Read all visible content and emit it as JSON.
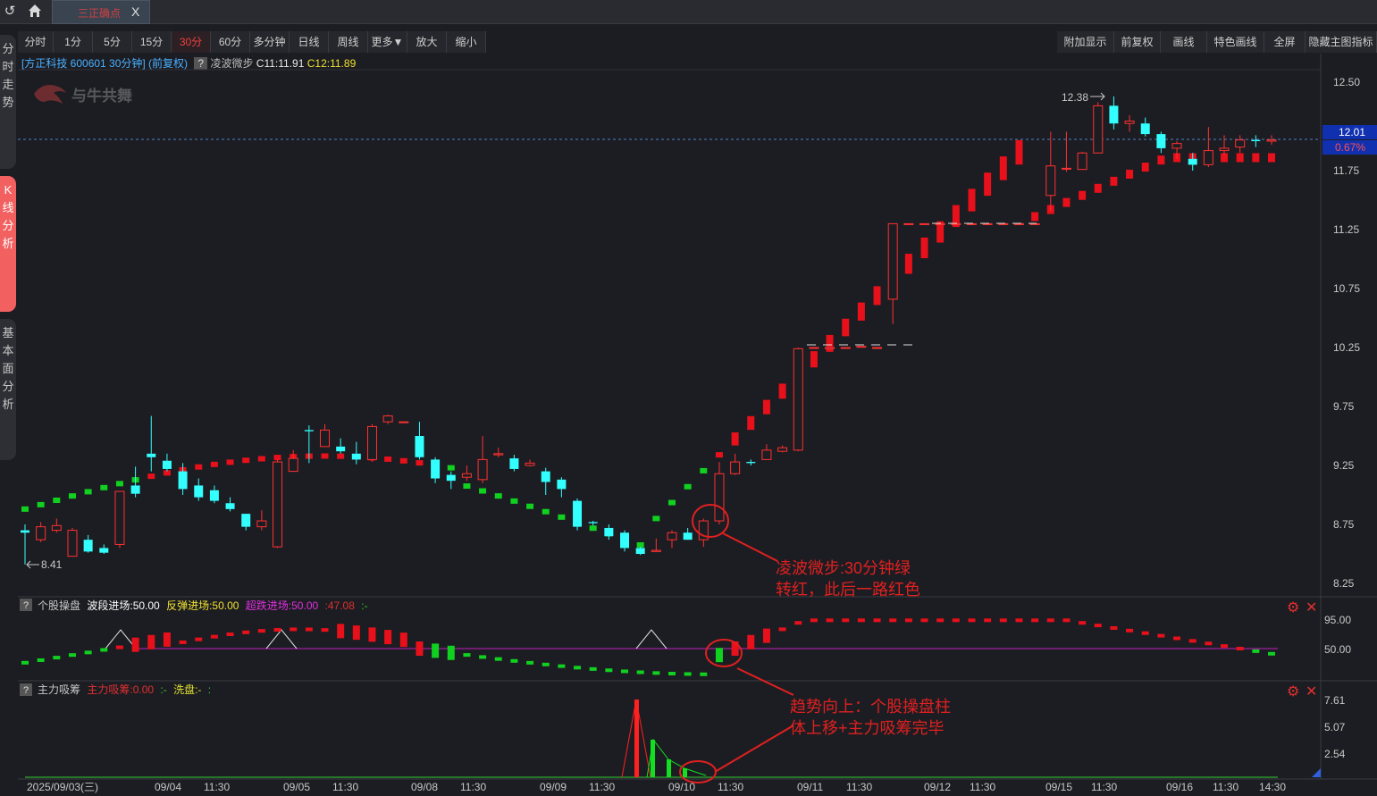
{
  "topbar": {
    "back_icon": "back-arrow-icon",
    "home_icon": "home-icon",
    "doc_tab": "三正确点",
    "close": "X"
  },
  "sidebar": [
    "分时走势",
    "K线分析",
    "基本面分析"
  ],
  "toolbar_left": [
    "分时",
    "1分",
    "5分",
    "15分",
    "30分",
    "60分",
    "多分钟",
    "日线",
    "周线",
    "更多▼",
    "放大",
    "缩小"
  ],
  "toolbar_active": "30分",
  "toolbar_right": [
    "附加显示",
    "前复权",
    "画线",
    "特色画线",
    "全屏",
    "隐藏主图指标"
  ],
  "info": {
    "stock": "[方正科技 600601 30分钟] (前复权)",
    "q": "?",
    "indicator": "凌波微步",
    "c11": "C11:11.91",
    "c12": "C12:11.89"
  },
  "watermark": "与牛共舞",
  "price_axis": [
    "12.50",
    "11.75",
    "11.25",
    "10.75",
    "10.25",
    "9.75",
    "9.25",
    "8.75",
    "8.25"
  ],
  "current_price": "12.01",
  "current_pct": "0.67%",
  "high_label": "12.38",
  "low_label": "8.41",
  "annotation1": [
    "凌波微步:30分钟绿",
    "转红，此后一路红色"
  ],
  "annotation2": [
    "趋势向上：个股操盘柱",
    "体上移+主力吸筹完毕"
  ],
  "panel2": {
    "q": "?",
    "name": "个股操盘",
    "a": "波段进场:50.00",
    "b": "反弹进场:50.00",
    "c": "超跌进场:50.00",
    "d": ":47.08",
    "e": ":-",
    "axis": [
      "95.00",
      "50.00"
    ]
  },
  "panel3": {
    "q": "?",
    "name": "主力吸筹",
    "a": "主力吸筹:0.00",
    "b": ":-",
    "c": "洗盘:-",
    "d": ":",
    "axis": [
      "7.61",
      "5.07",
      "2.54"
    ]
  },
  "time_axis": [
    "2025/09/03(三)",
    "09/04",
    "11:30",
    "09/05",
    "11:30",
    "09/08",
    "11:30",
    "09/09",
    "11:30",
    "09/10",
    "11:30",
    "09/11",
    "11:30",
    "09/12",
    "11:30",
    "09/15",
    "11:30",
    "09/16",
    "11:30",
    "14:30"
  ],
  "colors": {
    "up": "#ff3030",
    "down": "#33ffff",
    "ma_red": "#e8101a",
    "ma_green": "#10d020",
    "purple": "#c020c0",
    "annotation": "#e02020"
  },
  "chart_data": {
    "type": "candlestick",
    "candles": [
      [
        8.7,
        8.68,
        8.75,
        8.41
      ],
      [
        8.62,
        8.73,
        8.77,
        8.6
      ],
      [
        8.7,
        8.74,
        8.8,
        8.68
      ],
      [
        8.48,
        8.7,
        8.72,
        8.48
      ],
      [
        8.62,
        8.52,
        8.66,
        8.51
      ],
      [
        8.55,
        8.51,
        8.58,
        8.5
      ],
      [
        8.58,
        9.03,
        9.03,
        8.55
      ],
      [
        9.08,
        9.01,
        9.24,
        8.98
      ],
      [
        9.35,
        9.32,
        9.67,
        9.2
      ],
      [
        9.29,
        9.22,
        9.35,
        9.2
      ],
      [
        9.2,
        9.05,
        9.27,
        9.0
      ],
      [
        9.08,
        8.98,
        9.14,
        8.95
      ],
      [
        9.04,
        8.95,
        9.08,
        8.93
      ],
      [
        8.93,
        8.88,
        8.98,
        8.86
      ],
      [
        8.84,
        8.73,
        8.84,
        8.7
      ],
      [
        8.73,
        8.78,
        8.87,
        8.7
      ],
      [
        8.56,
        9.28,
        9.3,
        8.55
      ],
      [
        9.2,
        9.31,
        9.38,
        9.2
      ],
      [
        9.55,
        9.54,
        9.59,
        9.27
      ],
      [
        9.41,
        9.55,
        9.6,
        9.41
      ],
      [
        9.41,
        9.37,
        9.48,
        9.35
      ],
      [
        9.35,
        9.3,
        9.45,
        9.26
      ],
      [
        9.3,
        9.58,
        9.6,
        9.28
      ],
      [
        9.62,
        9.67,
        9.68,
        9.6
      ],
      [
        9.62,
        9.62,
        9.62,
        9.62
      ],
      [
        9.5,
        9.32,
        9.62,
        9.3
      ],
      [
        9.3,
        9.14,
        9.32,
        9.1
      ],
      [
        9.17,
        9.12,
        9.2,
        9.05
      ],
      [
        9.15,
        9.18,
        9.25,
        9.12
      ],
      [
        9.13,
        9.3,
        9.5,
        9.1
      ],
      [
        9.34,
        9.35,
        9.4,
        9.32
      ],
      [
        9.31,
        9.22,
        9.34,
        9.2
      ],
      [
        9.25,
        9.27,
        9.3,
        9.24
      ],
      [
        9.2,
        9.11,
        9.23,
        9.0
      ],
      [
        9.13,
        9.05,
        9.15,
        8.98
      ],
      [
        8.95,
        8.73,
        8.97,
        8.7
      ],
      [
        8.77,
        8.76,
        8.78,
        8.74
      ],
      [
        8.72,
        8.65,
        8.75,
        8.62
      ],
      [
        8.68,
        8.55,
        8.7,
        8.52
      ],
      [
        8.55,
        8.5,
        8.56,
        8.49
      ],
      [
        8.52,
        8.53,
        8.63,
        8.52
      ],
      [
        8.62,
        8.68,
        8.7,
        8.55
      ],
      [
        8.68,
        8.62,
        8.72,
        8.62
      ],
      [
        8.62,
        8.78,
        8.8,
        8.56
      ],
      [
        8.78,
        9.18,
        9.28,
        8.75
      ],
      [
        9.18,
        9.28,
        9.35,
        9.17
      ],
      [
        9.28,
        9.27,
        9.3,
        9.25
      ],
      [
        9.3,
        9.38,
        9.43,
        9.3
      ],
      [
        9.37,
        9.4,
        9.42,
        9.36
      ],
      [
        9.38,
        10.24,
        10.25,
        9.37
      ],
      [
        10.25,
        10.25,
        10.25,
        10.25
      ],
      [
        10.24,
        10.25,
        10.25,
        10.24
      ],
      [
        10.25,
        10.25,
        10.25,
        10.25
      ],
      [
        10.26,
        10.26,
        10.26,
        10.26
      ],
      [
        10.25,
        10.25,
        10.25,
        10.25
      ],
      [
        10.66,
        11.3,
        11.3,
        10.45
      ],
      [
        11.3,
        11.3,
        11.3,
        11.3
      ],
      [
        11.3,
        11.3,
        11.3,
        11.3
      ],
      [
        11.3,
        11.3,
        11.3,
        11.3
      ],
      [
        11.3,
        11.3,
        11.3,
        11.3
      ],
      [
        11.3,
        11.3,
        11.3,
        11.3
      ],
      [
        11.3,
        11.3,
        11.3,
        11.3
      ],
      [
        11.3,
        11.3,
        11.3,
        11.3
      ],
      [
        11.3,
        11.3,
        11.3,
        11.3
      ],
      [
        11.3,
        11.3,
        11.3,
        11.3
      ],
      [
        11.54,
        11.79,
        12.08,
        11.41
      ],
      [
        11.77,
        11.77,
        12.08,
        11.74
      ],
      [
        11.76,
        11.9,
        11.91,
        11.76
      ],
      [
        11.9,
        12.3,
        12.33,
        11.9
      ],
      [
        12.3,
        12.15,
        12.38,
        12.1
      ],
      [
        12.15,
        12.17,
        12.22,
        12.08
      ],
      [
        12.15,
        12.06,
        12.2,
        12.04
      ],
      [
        12.06,
        11.94,
        12.08,
        11.9
      ],
      [
        11.94,
        11.98,
        12.0,
        11.85
      ],
      [
        11.85,
        11.8,
        11.9,
        11.75
      ],
      [
        11.8,
        11.92,
        12.12,
        11.78
      ],
      [
        11.92,
        11.94,
        12.05,
        11.88
      ],
      [
        11.95,
        12.01,
        12.05,
        11.9
      ],
      [
        12.01,
        12.0,
        12.05,
        11.95
      ],
      [
        12.0,
        12.01,
        12.05,
        11.97
      ]
    ]
  }
}
